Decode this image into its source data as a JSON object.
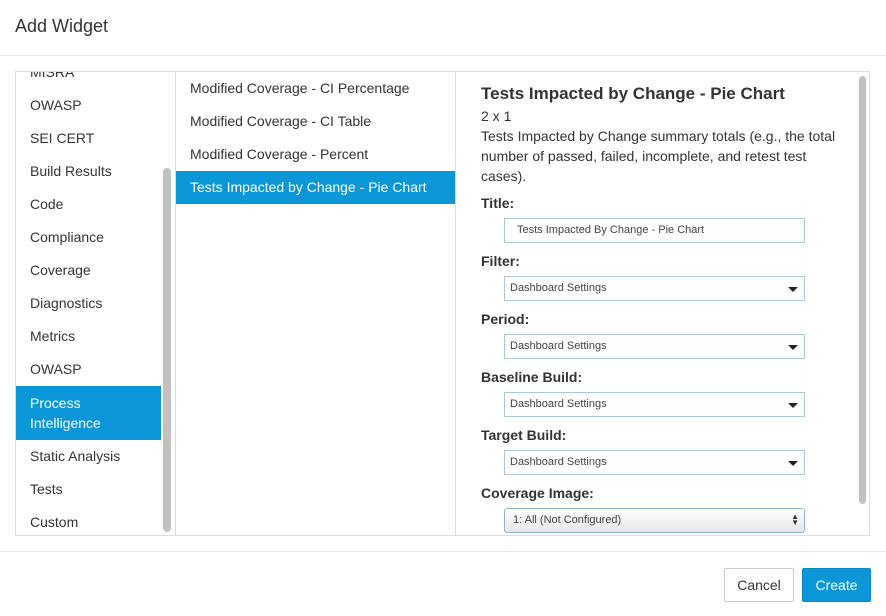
{
  "dialog": {
    "title": "Add Widget"
  },
  "categories": [
    {
      "label": "MISRA"
    },
    {
      "label": "OWASP"
    },
    {
      "label": "SEI CERT"
    },
    {
      "label": "Build Results"
    },
    {
      "label": "Code"
    },
    {
      "label": "Compliance"
    },
    {
      "label": "Coverage"
    },
    {
      "label": "Diagnostics"
    },
    {
      "label": "Metrics"
    },
    {
      "label": "OWASP"
    },
    {
      "label": "Process Intelligence",
      "selected": true
    },
    {
      "label": "Static Analysis"
    },
    {
      "label": "Tests"
    },
    {
      "label": "Custom"
    }
  ],
  "widgets": [
    {
      "label": "Modified Coverage - CI Percentage"
    },
    {
      "label": "Modified Coverage - CI Table"
    },
    {
      "label": "Modified Coverage - Percent"
    },
    {
      "label": "Tests Impacted by Change - Pie Chart",
      "selected": true
    }
  ],
  "details": {
    "title": "Tests Impacted by Change - Pie Chart",
    "size": "2 x 1",
    "description": "Tests Impacted by Change summary totals (e.g., the total number of passed, failed, incomplete, and retest test cases).",
    "fields": {
      "title": {
        "label": "Title:",
        "value": "Tests Impacted By Change - Pie Chart"
      },
      "filter": {
        "label": "Filter:",
        "value": "Dashboard Settings"
      },
      "period": {
        "label": "Period:",
        "value": "Dashboard Settings"
      },
      "baseline": {
        "label": "Baseline Build:",
        "value": "Dashboard Settings"
      },
      "target": {
        "label": "Target Build:",
        "value": "Dashboard Settings"
      },
      "coverage": {
        "label": "Coverage Image:",
        "value": "1: All (Not Configured)"
      }
    }
  },
  "footer": {
    "cancel_label": "Cancel",
    "create_label": "Create"
  },
  "colors": {
    "accent": "#0b96d8"
  }
}
